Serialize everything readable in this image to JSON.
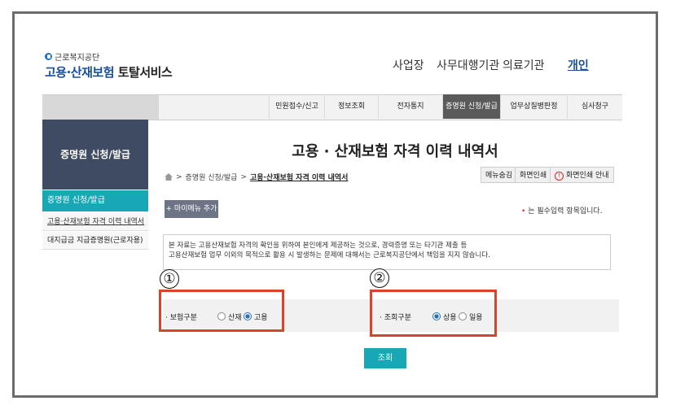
{
  "header": {
    "org_small": "근로복지공단",
    "logo_main": "고용·산재보험",
    "logo_sub": "토탈서비스",
    "nav": [
      "사업장",
      "사무대행기관",
      "의료기관",
      "개인"
    ]
  },
  "menubar": {
    "items": [
      "민원접수/신고",
      "정보조회",
      "전자통지",
      "증명원 신청/발급",
      "업무상질병판정",
      "심사청구"
    ],
    "active_index": 3
  },
  "sidebar": {
    "heading": "증명원 신청/발급",
    "selected": "증명원 신청/발급",
    "items": [
      "고용·산재보험 자격 이력 내역서",
      "대지급금 지급증명원(근로자용)"
    ]
  },
  "main": {
    "title": "고용 · 산재보험 자격 이력 내역서",
    "breadcrumb": {
      "sep": ">",
      "parent": "증명원 신청/발급",
      "current": "고용·산재보험 자격 이력 내역서"
    },
    "buttons": {
      "hide_menu": "메뉴숨김",
      "print": "화면인쇄",
      "print_guide": "화면인쇄 안내"
    },
    "my_menu": "+ 마이메뉴 추가",
    "required_note": "는 필수입력 항목입니다.",
    "notice_line1": "본 자료는 고용산재보험 자격의 확인을 위하여 본인에게 제공하는 것으로, 경력증명 또는 타기관 제출 등",
    "notice_line2": "고용산재보험 업무 이외의 목적으로 활용 시 발생하는 문제에 대해서는 근로복지공단에서 책임을 지지 않습니다.",
    "insurance": {
      "label": "보험구분",
      "options": [
        "산재",
        "고용"
      ],
      "selected": "고용"
    },
    "query_type": {
      "label": "조회구분",
      "options": [
        "상용",
        "일용"
      ],
      "selected": "상용"
    },
    "search_button": "조회",
    "callouts": [
      "①",
      "②"
    ]
  },
  "colors": {
    "accent": "#18a7b5",
    "callout": "#d9432b",
    "sidebar_head": "#3f4a63"
  }
}
